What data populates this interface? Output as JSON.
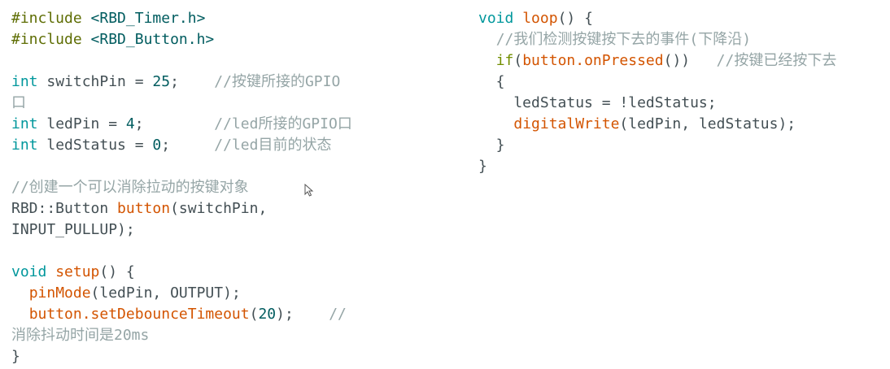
{
  "code": {
    "left": [
      [
        {
          "t": "#include ",
          "k": "pre"
        },
        {
          "t": "<RBD_Timer.h>",
          "k": "incl"
        }
      ],
      [
        {
          "t": "#include ",
          "k": "pre"
        },
        {
          "t": "<RBD_Button.h>",
          "k": "incl"
        }
      ],
      [],
      [
        {
          "t": "int",
          "k": "type"
        },
        {
          "t": " switchPin = ",
          "k": "plain"
        },
        {
          "t": "25",
          "k": "num"
        },
        {
          "t": ";    ",
          "k": "plain"
        },
        {
          "t": "//按键所接的GPIO",
          "k": "cmt"
        }
      ],
      [
        {
          "t": "口",
          "k": "cmt"
        }
      ],
      [
        {
          "t": "int",
          "k": "type"
        },
        {
          "t": " ledPin = ",
          "k": "plain"
        },
        {
          "t": "4",
          "k": "num"
        },
        {
          "t": ";        ",
          "k": "plain"
        },
        {
          "t": "//led所接的GPIO口",
          "k": "cmt"
        }
      ],
      [
        {
          "t": "int",
          "k": "type"
        },
        {
          "t": " ledStatus = ",
          "k": "plain"
        },
        {
          "t": "0",
          "k": "num"
        },
        {
          "t": ";     ",
          "k": "plain"
        },
        {
          "t": "//led目前的状态",
          "k": "cmt"
        }
      ],
      [],
      [
        {
          "t": "//创建一个可以消除拉动的按键对象",
          "k": "cmt"
        }
      ],
      [
        {
          "t": "RBD::Button ",
          "k": "plain"
        },
        {
          "t": "button",
          "k": "fn"
        },
        {
          "t": "(switchPin,",
          "k": "plain"
        }
      ],
      [
        {
          "t": "INPUT_PULLUP);",
          "k": "plain"
        }
      ],
      [],
      [
        {
          "t": "void",
          "k": "type"
        },
        {
          "t": " ",
          "k": "plain"
        },
        {
          "t": "setup",
          "k": "fn"
        },
        {
          "t": "() {",
          "k": "plain"
        }
      ],
      [
        {
          "t": "  ",
          "k": "plain"
        },
        {
          "t": "pinMode",
          "k": "fn"
        },
        {
          "t": "(ledPin, OUTPUT);",
          "k": "plain"
        }
      ],
      [
        {
          "t": "  ",
          "k": "plain"
        },
        {
          "t": "button.setDebounceTimeout",
          "k": "fn"
        },
        {
          "t": "(",
          "k": "plain"
        },
        {
          "t": "20",
          "k": "num"
        },
        {
          "t": ");    ",
          "k": "plain"
        },
        {
          "t": "//",
          "k": "cmt"
        }
      ],
      [
        {
          "t": "消除抖动时间是20ms",
          "k": "cmt"
        }
      ],
      [
        {
          "t": "}",
          "k": "plain"
        }
      ]
    ],
    "right": [
      [
        {
          "t": "void",
          "k": "type"
        },
        {
          "t": " ",
          "k": "plain"
        },
        {
          "t": "loop",
          "k": "fn"
        },
        {
          "t": "() {",
          "k": "plain"
        }
      ],
      [
        {
          "t": "  ",
          "k": "plain"
        },
        {
          "t": "//我们检测按键按下去的事件(下降沿)",
          "k": "cmt"
        }
      ],
      [
        {
          "t": "  ",
          "k": "plain"
        },
        {
          "t": "if",
          "k": "ctrl"
        },
        {
          "t": "(",
          "k": "plain"
        },
        {
          "t": "button.onPressed",
          "k": "fn"
        },
        {
          "t": "())   ",
          "k": "plain"
        },
        {
          "t": "//按键已经按下去",
          "k": "cmt"
        }
      ],
      [
        {
          "t": "  {",
          "k": "plain"
        }
      ],
      [
        {
          "t": "    ledStatus = !ledStatus;",
          "k": "plain"
        }
      ],
      [
        {
          "t": "    ",
          "k": "plain"
        },
        {
          "t": "digitalWrite",
          "k": "fn"
        },
        {
          "t": "(ledPin, ledStatus);",
          "k": "plain"
        }
      ],
      [
        {
          "t": "  }",
          "k": "plain"
        }
      ],
      [
        {
          "t": "}",
          "k": "plain"
        }
      ]
    ]
  },
  "icons": {
    "cursor": "mouse-pointer-icon"
  }
}
